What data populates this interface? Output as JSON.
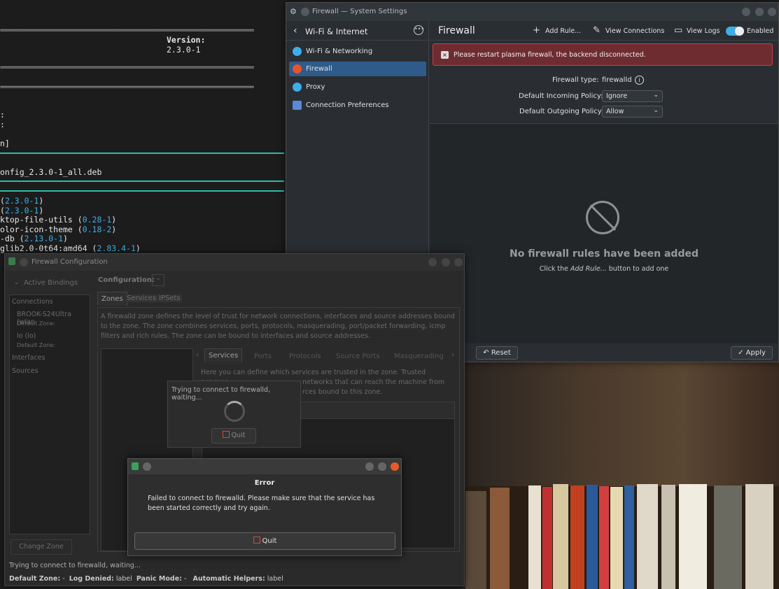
{
  "terminal": {
    "version_label": "Version:",
    "version_value": "2.3.0-1",
    "line_n": "n]",
    "deb_file": "onfig_2.3.0-1_all.deb",
    "deps": [
      {
        "pre": "(",
        "ver": "2.3.0-1",
        "post": ")"
      },
      {
        "pre": "(",
        "ver": "2.3.0-1",
        "post": ")"
      },
      {
        "pre": "ktop-file-utils (",
        "ver": "0.28-1",
        "post": ")"
      },
      {
        "pre": "olor-icon-theme (",
        "ver": "0.18-2",
        "post": ")"
      },
      {
        "pre": "-db (",
        "ver": "2.13.0-1",
        "post": ")"
      },
      {
        "pre": "glib2.0-0t64:amd64 (",
        "ver": "2.83.4-1",
        "post": ")"
      }
    ]
  },
  "settings": {
    "window_title": "Firewall — System Settings",
    "sidebar_header": "Wi-Fi & Internet",
    "sidebar_items": [
      {
        "label": "Wi-Fi & Networking",
        "color": "#3daee9"
      },
      {
        "label": "Firewall",
        "color": "#e8542a"
      },
      {
        "label": "Proxy",
        "color": "#3daee9"
      },
      {
        "label": "Connection Preferences",
        "color": "#5a8ad6"
      }
    ],
    "page_title": "Firewall",
    "toolbar": {
      "add_rule": "Add Rule...",
      "view_connections": "View Connections",
      "view_logs": "View Logs",
      "enabled": "Enabled"
    },
    "error_banner": "Please restart plasma firewall, the backend disconnected.",
    "firewall_type_label": "Firewall type:",
    "firewall_type_value": "firewalld",
    "incoming_label": "Default Incoming Policy:",
    "incoming_value": "Ignore",
    "outgoing_label": "Default Outgoing Policy:",
    "outgoing_value": "Allow",
    "empty_title": "No firewall rules have been added",
    "empty_sub_pre": "Click the ",
    "empty_sub_em": "Add Rule...",
    "empty_sub_post": " button to add one",
    "reset": "Reset",
    "apply": "Apply"
  },
  "fwconf": {
    "window_title": "Firewall Configuration",
    "active_bindings": "Active Bindings",
    "connections": "Connections",
    "conn1_name": "BROOK-S24Ultra (wlan",
    "conn1_zone": "Default Zone:",
    "conn2_name": "lo (lo)",
    "conn2_zone": "Default Zone:",
    "interfaces": "Interfaces",
    "sources": "Sources",
    "change_zone": "Change Zone",
    "configuration_label": "Configuration:",
    "tabs": [
      "Zones",
      "Services",
      "IPSets"
    ],
    "zone_desc": "A firewalld zone defines the level of trust for network connections, interfaces and source addresses bound to the zone. The zone combines services, ports, protocols, masquerading, port/packet forwarding, icmp filters and rich rules. The zone can be bound to interfaces and source addresses.",
    "subtabs": [
      "Services",
      "Ports",
      "Protocols",
      "Source Ports",
      "Masquerading"
    ],
    "services_desc_1": "Here you can define which services are trusted in the zone. Trusted services",
    "services_desc_2": "networks that can reach the machine from",
    "services_desc_3": "rces bound to this zone.",
    "status_text": "Trying to connect to firewalld, waiting...",
    "status_bar": {
      "default_zone_label": "Default Zone:",
      "default_zone_value": "-",
      "log_denied_label": "Log Denied:",
      "log_denied_value": "label",
      "panic_label": "Panic Mode:",
      "panic_value": "-",
      "helpers_label": "Automatic Helpers:",
      "helpers_value": "label"
    }
  },
  "connect_popup": {
    "text": "Trying to connect to firewalld, waiting...",
    "quit": "Quit"
  },
  "error_dialog": {
    "title": "Error",
    "message": "Failed to connect to firewalld. Please make sure that the service has been started correctly and try again.",
    "quit": "Quit"
  }
}
